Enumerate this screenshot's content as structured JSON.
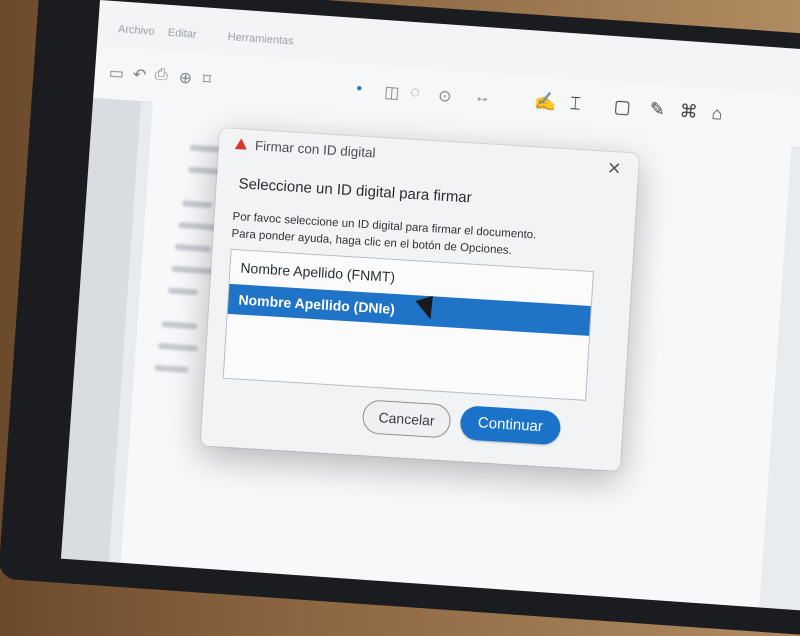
{
  "menubar": {
    "items": [
      "Archivo",
      "Editar",
      "Herramientas"
    ]
  },
  "toolbar": {
    "icons": [
      "page-icon",
      "undo-icon",
      "print-icon",
      "zoom-icon",
      "bookmark-icon",
      "pointer-icon",
      "hand-icon",
      "comment-icon",
      "search-icon",
      "fit-icon",
      "sign-icon",
      "highlight-icon",
      "note-icon",
      "pen-icon",
      "stamp-icon",
      "attach-icon"
    ]
  },
  "dialog": {
    "title": "Firmar con ID digital",
    "close_symbol": "✕",
    "heading": "Seleccione un ID digital para firmar",
    "description_line1": "Por favoc seleccione un ID digital para firmar el documento.",
    "description_line2": "Para ponder ayuda, haga clic en el botón de Opciones.",
    "ids": [
      {
        "label": "Nombre Apellido (FNMT)",
        "selected": false
      },
      {
        "label": "Nombre Apellido (DNIe)",
        "selected": true
      }
    ],
    "cancel_label": "Cancelar",
    "continue_label": "Continuar"
  },
  "colors": {
    "accent": "#1f74c7",
    "app_icon": "#d8382b",
    "dialog_bg": "#f2f3f5"
  }
}
